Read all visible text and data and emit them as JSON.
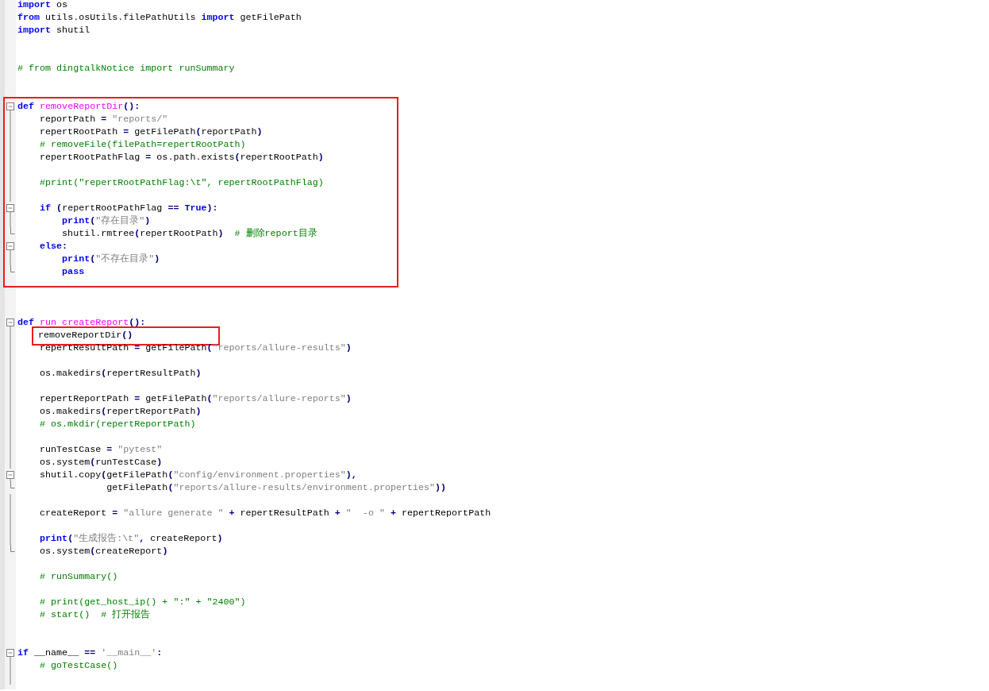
{
  "editor": {
    "blocks": [
      {
        "kind": "plain",
        "lines": [
          {
            "kind": "code",
            "tokens": [
              {
                "kind": "keyword",
                "text": "import"
              },
              {
                "kind": "plain",
                "text": " os"
              }
            ]
          },
          {
            "kind": "code",
            "tokens": [
              {
                "kind": "keyword",
                "text": "from"
              },
              {
                "kind": "plain",
                "text": " utils.osUtils.filePathUtils "
              },
              {
                "kind": "keyword",
                "text": "import"
              },
              {
                "kind": "plain",
                "text": " getFilePath"
              }
            ]
          },
          {
            "kind": "code",
            "tokens": [
              {
                "kind": "keyword",
                "text": "import"
              },
              {
                "kind": "plain",
                "text": " shutil"
              }
            ]
          },
          {
            "kind": "blank"
          },
          {
            "kind": "blank"
          },
          {
            "kind": "code",
            "tokens": [
              {
                "kind": "comment",
                "text": "# from dingtalkNotice import runSummary"
              }
            ]
          },
          {
            "kind": "blank"
          },
          {
            "kind": "blank"
          }
        ]
      },
      {
        "kind": "boxed_block",
        "lines": [
          {
            "kind": "code",
            "fold_start": true,
            "tokens": [
              {
                "kind": "keyword",
                "text": "def"
              },
              {
                "kind": "function",
                "text": " removeReportDir"
              },
              {
                "kind": "operator",
                "text": "():"
              }
            ]
          },
          {
            "kind": "code",
            "fold_body": true,
            "tokens": [
              {
                "kind": "plain",
                "text": "    reportPath "
              },
              {
                "kind": "operator",
                "text": "="
              },
              {
                "kind": "string",
                "text": " \"reports/\""
              }
            ]
          },
          {
            "kind": "code",
            "fold_body": true,
            "tokens": [
              {
                "kind": "plain",
                "text": "    repertRootPath "
              },
              {
                "kind": "operator",
                "text": "="
              },
              {
                "kind": "plain",
                "text": " getFilePath"
              },
              {
                "kind": "operator",
                "text": "("
              },
              {
                "kind": "plain",
                "text": "reportPath"
              },
              {
                "kind": "operator",
                "text": ")"
              }
            ]
          },
          {
            "kind": "code",
            "fold_body": true,
            "tokens": [
              {
                "kind": "comment",
                "text": "    # removeFile(filePath=repertRootPath)"
              }
            ]
          },
          {
            "kind": "code",
            "fold_body": true,
            "tokens": [
              {
                "kind": "plain",
                "text": "    repertRootPathFlag "
              },
              {
                "kind": "operator",
                "text": "="
              },
              {
                "kind": "plain",
                "text": " os.path.exists"
              },
              {
                "kind": "operator",
                "text": "("
              },
              {
                "kind": "plain",
                "text": "repertRootPath"
              },
              {
                "kind": "operator",
                "text": ")"
              }
            ]
          },
          {
            "kind": "blank",
            "fold_body": true
          },
          {
            "kind": "code",
            "fold_body": true,
            "tokens": [
              {
                "kind": "comment",
                "text": "    #print(\"repertRootPathFlag:\\t\", repertRootPathFlag)"
              }
            ]
          },
          {
            "kind": "blank",
            "fold_body": true
          },
          {
            "kind": "code",
            "fold_start": true,
            "tokens": [
              {
                "kind": "keyword",
                "text": "    if"
              },
              {
                "kind": "operator",
                "text": " ("
              },
              {
                "kind": "plain",
                "text": "repertRootPathFlag "
              },
              {
                "kind": "operator",
                "text": "=="
              },
              {
                "kind": "keyword",
                "text": " True"
              },
              {
                "kind": "operator",
                "text": "):"
              }
            ]
          },
          {
            "kind": "code",
            "fold_body": true,
            "tokens": [
              {
                "kind": "keyword",
                "text": "        print"
              },
              {
                "kind": "operator",
                "text": "("
              },
              {
                "kind": "string",
                "text": "\"存在目录\""
              },
              {
                "kind": "operator",
                "text": ")"
              }
            ]
          },
          {
            "kind": "code",
            "fold_end": true,
            "tokens": [
              {
                "kind": "plain",
                "text": "        shutil.rmtree"
              },
              {
                "kind": "operator",
                "text": "("
              },
              {
                "kind": "plain",
                "text": "repertRootPath"
              },
              {
                "kind": "operator",
                "text": ")"
              },
              {
                "kind": "comment",
                "text": "  # 删除report目录"
              }
            ]
          },
          {
            "kind": "code",
            "fold_start": true,
            "tokens": [
              {
                "kind": "keyword",
                "text": "    else"
              },
              {
                "kind": "operator",
                "text": ":"
              }
            ]
          },
          {
            "kind": "code",
            "fold_body": true,
            "tokens": [
              {
                "kind": "keyword",
                "text": "        print"
              },
              {
                "kind": "operator",
                "text": "("
              },
              {
                "kind": "string",
                "text": "\"不存在目录\""
              },
              {
                "kind": "operator",
                "text": ")"
              }
            ]
          },
          {
            "kind": "code",
            "fold_end": true,
            "tokens": [
              {
                "kind": "keyword",
                "text": "        pass"
              }
            ]
          }
        ]
      },
      {
        "kind": "plain",
        "lines": [
          {
            "kind": "blank"
          },
          {
            "kind": "blank"
          },
          {
            "kind": "blank"
          },
          {
            "kind": "code",
            "fold_start": true,
            "tokens": [
              {
                "kind": "keyword",
                "text": "def"
              },
              {
                "kind": "function",
                "text": " run createReport"
              },
              {
                "kind": "operator",
                "text": "():"
              }
            ]
          }
        ]
      },
      {
        "kind": "boxed_line",
        "lines": [
          {
            "kind": "code",
            "fold_body": true,
            "tokens": [
              {
                "kind": "plain",
                "text": "removeReportDir"
              },
              {
                "kind": "operator",
                "text": "()"
              }
            ]
          }
        ]
      },
      {
        "kind": "plain",
        "lines": [
          {
            "kind": "code",
            "fold_body": true,
            "tokens": [
              {
                "kind": "plain",
                "text": "    repertResultPath "
              },
              {
                "kind": "operator",
                "text": "="
              },
              {
                "kind": "plain",
                "text": " getFilePath"
              },
              {
                "kind": "operator",
                "text": "("
              },
              {
                "kind": "string",
                "text": "\"reports/allure-results\""
              },
              {
                "kind": "operator",
                "text": ")"
              }
            ]
          },
          {
            "kind": "blank",
            "fold_body": true
          },
          {
            "kind": "code",
            "fold_body": true,
            "tokens": [
              {
                "kind": "plain",
                "text": "    os.makedirs"
              },
              {
                "kind": "operator",
                "text": "("
              },
              {
                "kind": "plain",
                "text": "repertResultPath"
              },
              {
                "kind": "operator",
                "text": ")"
              }
            ]
          },
          {
            "kind": "blank",
            "fold_body": true
          },
          {
            "kind": "code",
            "fold_body": true,
            "tokens": [
              {
                "kind": "plain",
                "text": "    repertReportPath "
              },
              {
                "kind": "operator",
                "text": "="
              },
              {
                "kind": "plain",
                "text": " getFilePath"
              },
              {
                "kind": "operator",
                "text": "("
              },
              {
                "kind": "string",
                "text": "\"reports/allure-reports\""
              },
              {
                "kind": "operator",
                "text": ")"
              }
            ]
          },
          {
            "kind": "code",
            "fold_body": true,
            "tokens": [
              {
                "kind": "plain",
                "text": "    os.makedirs"
              },
              {
                "kind": "operator",
                "text": "("
              },
              {
                "kind": "plain",
                "text": "repertReportPath"
              },
              {
                "kind": "operator",
                "text": ")"
              }
            ]
          },
          {
            "kind": "code",
            "fold_body": true,
            "tokens": [
              {
                "kind": "comment",
                "text": "    # os.mkdir(repertReportPath)"
              }
            ]
          },
          {
            "kind": "blank",
            "fold_body": true
          },
          {
            "kind": "code",
            "fold_body": true,
            "tokens": [
              {
                "kind": "plain",
                "text": "    runTestCase "
              },
              {
                "kind": "operator",
                "text": "="
              },
              {
                "kind": "string",
                "text": " \"pytest\""
              }
            ]
          },
          {
            "kind": "code",
            "fold_body": true,
            "tokens": [
              {
                "kind": "plain",
                "text": "    os.system"
              },
              {
                "kind": "operator",
                "text": "("
              },
              {
                "kind": "plain",
                "text": "runTestCase"
              },
              {
                "kind": "operator",
                "text": ")"
              }
            ]
          },
          {
            "kind": "code",
            "fold_start": true,
            "tokens": [
              {
                "kind": "plain",
                "text": "    shutil.copy"
              },
              {
                "kind": "operator",
                "text": "("
              },
              {
                "kind": "plain",
                "text": "getFilePath"
              },
              {
                "kind": "operator",
                "text": "("
              },
              {
                "kind": "string",
                "text": "\"config/environment.properties\""
              },
              {
                "kind": "operator",
                "text": "),"
              }
            ]
          },
          {
            "kind": "code",
            "fold_end": true,
            "tokens": [
              {
                "kind": "plain",
                "text": "                getFilePath"
              },
              {
                "kind": "operator",
                "text": "("
              },
              {
                "kind": "string",
                "text": "\"reports/allure-results/environment.properties\""
              },
              {
                "kind": "operator",
                "text": "))"
              }
            ]
          },
          {
            "kind": "blank",
            "fold_body": true
          },
          {
            "kind": "code",
            "fold_body": true,
            "tokens": [
              {
                "kind": "plain",
                "text": "    createReport "
              },
              {
                "kind": "operator",
                "text": "="
              },
              {
                "kind": "string",
                "text": " \"allure generate \""
              },
              {
                "kind": "operator",
                "text": " +"
              },
              {
                "kind": "plain",
                "text": " repertResultPath "
              },
              {
                "kind": "operator",
                "text": "+"
              },
              {
                "kind": "string",
                "text": " \"  -o \""
              },
              {
                "kind": "operator",
                "text": " +"
              },
              {
                "kind": "plain",
                "text": " repertReportPath"
              }
            ]
          },
          {
            "kind": "blank",
            "fold_body": true
          },
          {
            "kind": "code",
            "fold_body": true,
            "tokens": [
              {
                "kind": "keyword",
                "text": "    print"
              },
              {
                "kind": "operator",
                "text": "("
              },
              {
                "kind": "string",
                "text": "\"生成报告:\\t\""
              },
              {
                "kind": "operator",
                "text": ","
              },
              {
                "kind": "plain",
                "text": " createReport"
              },
              {
                "kind": "operator",
                "text": ")"
              }
            ]
          },
          {
            "kind": "code",
            "fold_end": true,
            "tokens": [
              {
                "kind": "plain",
                "text": "    os.system"
              },
              {
                "kind": "operator",
                "text": "("
              },
              {
                "kind": "plain",
                "text": "createReport"
              },
              {
                "kind": "operator",
                "text": ")"
              }
            ]
          },
          {
            "kind": "blank"
          },
          {
            "kind": "code",
            "tokens": [
              {
                "kind": "comment",
                "text": "    # runSummary()"
              }
            ]
          },
          {
            "kind": "blank"
          },
          {
            "kind": "code",
            "tokens": [
              {
                "kind": "comment",
                "text": "    # print(get_host_ip() + \":\" + \"2400\")"
              }
            ]
          },
          {
            "kind": "code",
            "tokens": [
              {
                "kind": "comment",
                "text": "    # start()  # 打开报告"
              }
            ]
          },
          {
            "kind": "blank"
          },
          {
            "kind": "blank"
          },
          {
            "kind": "code",
            "fold_start": true,
            "tokens": [
              {
                "kind": "keyword",
                "text": "if"
              },
              {
                "kind": "plain",
                "text": " __name__ "
              },
              {
                "kind": "operator",
                "text": "=="
              },
              {
                "kind": "string",
                "text": " '__main__'"
              },
              {
                "kind": "operator",
                "text": ":"
              }
            ]
          },
          {
            "kind": "code",
            "fold_body": true,
            "tokens": [
              {
                "kind": "comment",
                "text": "    # goTestCase()"
              }
            ]
          },
          {
            "kind": "blank",
            "fold_body": true
          }
        ]
      }
    ]
  }
}
